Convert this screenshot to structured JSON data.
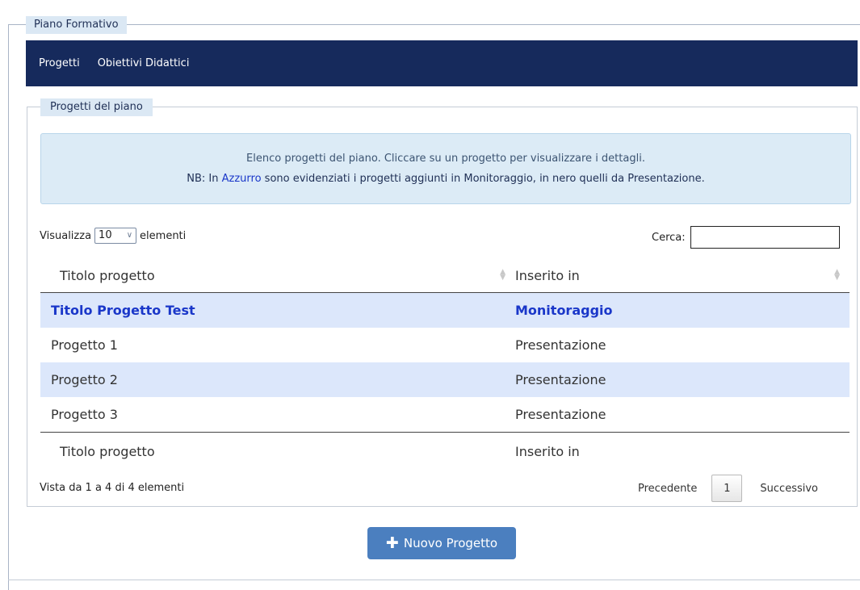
{
  "outer_legend": "Piano Formativo",
  "nav": {
    "items": [
      {
        "label": "Progetti"
      },
      {
        "label": "Obiettivi Didattici"
      }
    ]
  },
  "inner_legend": "Progetti del piano",
  "info_box": {
    "line1": "Elenco progetti del piano. Cliccare su un progetto per visualizzare i dettagli.",
    "line2_prefix": "NB: In ",
    "line2_highlight": "Azzurro",
    "line2_suffix": " sono evidenziati i progetti aggiunti in Monitoraggio, in nero quelli da Presentazione.",
    "highlight_color": "#1a37c9"
  },
  "length": {
    "prefix": "Visualizza",
    "value": "10",
    "suffix": "elementi"
  },
  "search": {
    "label": "Cerca:",
    "value": "",
    "placeholder": ""
  },
  "table": {
    "headers": [
      "Titolo progetto",
      "Inserito in"
    ],
    "rows": [
      {
        "title": "Titolo Progetto Test",
        "inserted_in": "Monitoraggio"
      },
      {
        "title": "Progetto 1",
        "inserted_in": "Presentazione"
      },
      {
        "title": "Progetto 2",
        "inserted_in": "Presentazione"
      },
      {
        "title": "Progetto 3",
        "inserted_in": "Presentazione"
      }
    ],
    "footers": [
      "Titolo progetto",
      "Inserito in"
    ]
  },
  "info_count": "Vista da 1 a 4 di 4 elementi",
  "pagination": {
    "prev": "Precedente",
    "current": "1",
    "next": "Successivo"
  },
  "new_button": {
    "icon": "plus-icon",
    "label": "Nuovo Progetto",
    "color": "#4b7fbf"
  },
  "colors": {
    "nav_bg": "#162a5c",
    "legend_bg": "#dbe8f4",
    "row_highlight_bg": "#dce7fb",
    "monitoraggio_text": "#1a37c9"
  }
}
